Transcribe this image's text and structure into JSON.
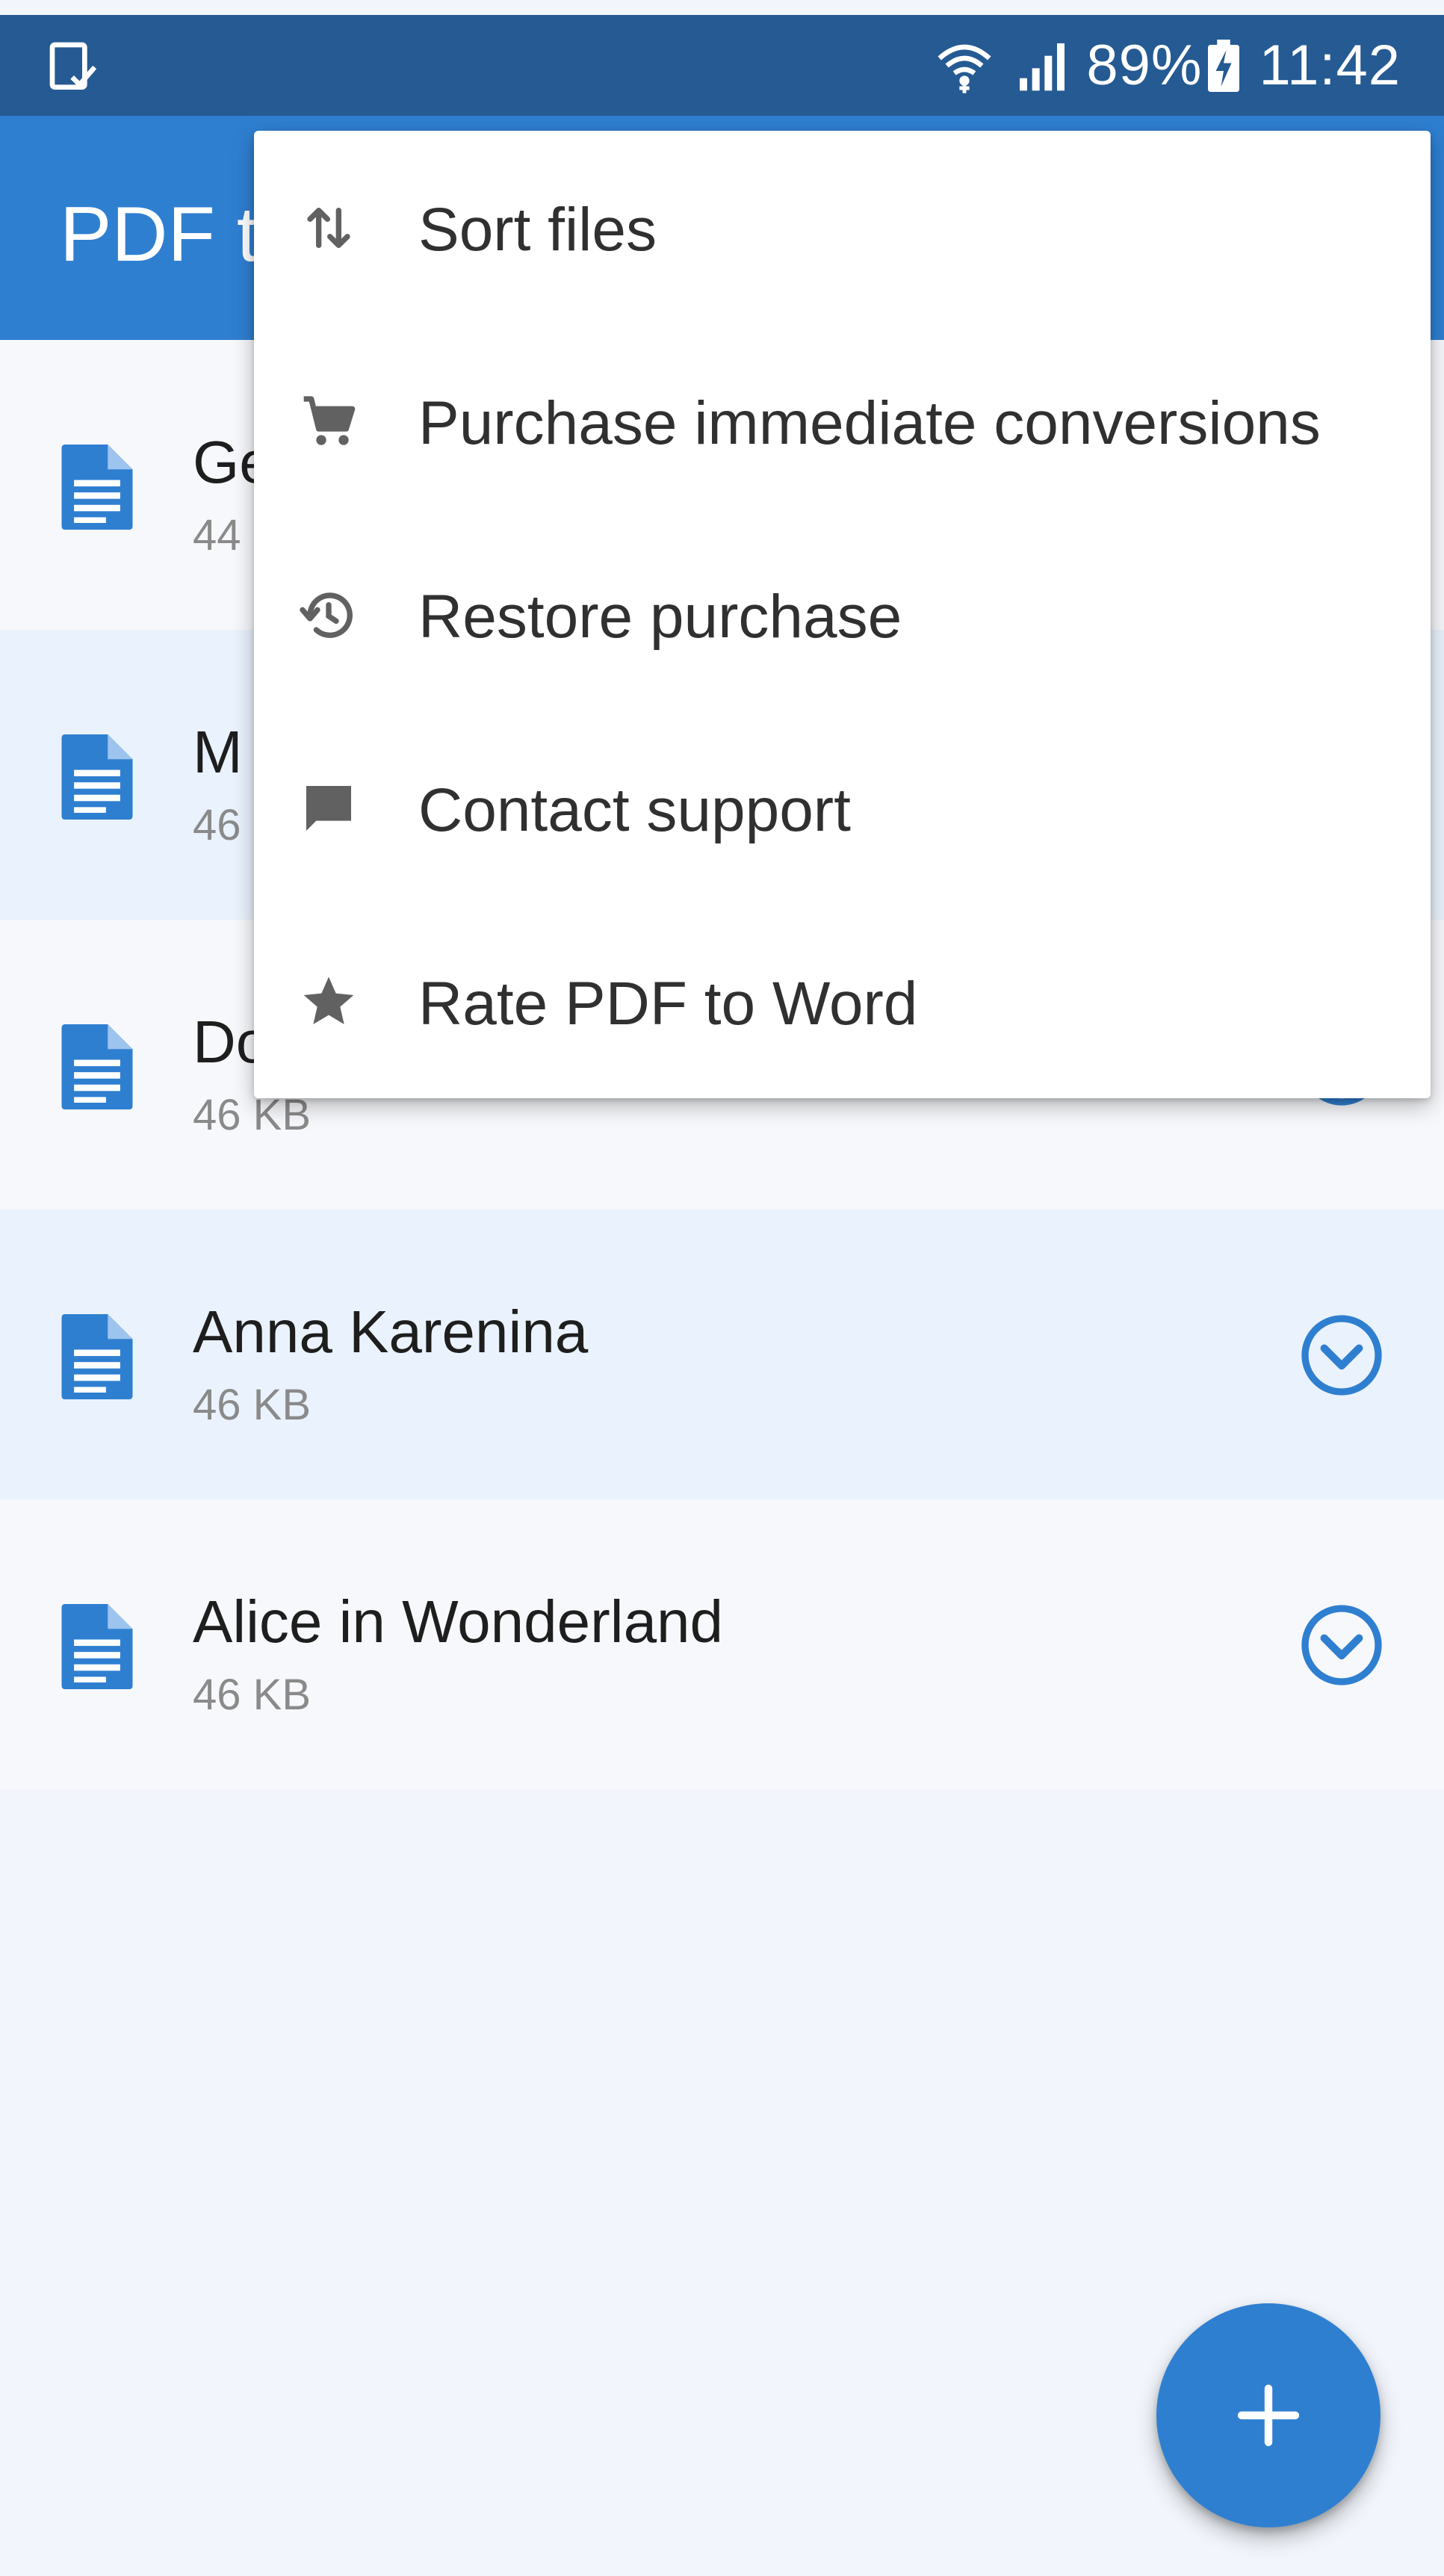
{
  "status_bar": {
    "battery_percent": "89%",
    "time": "11:42",
    "icons": [
      "screenshot-notification-icon",
      "wifi-icon",
      "signal-icon",
      "battery-charging-icon"
    ]
  },
  "app_bar": {
    "title": "PDF t"
  },
  "files": [
    {
      "name": "Ge",
      "size": "44"
    },
    {
      "name": "M",
      "size": "46"
    },
    {
      "name": "Do",
      "size": "46 KB"
    },
    {
      "name": "Anna Karenina",
      "size": "46 KB"
    },
    {
      "name": "Alice in Wonderland",
      "size": "46 KB"
    }
  ],
  "menu": {
    "items": [
      {
        "label": "Sort files",
        "icon": "sort-icon"
      },
      {
        "label": "Purchase immediate conversions",
        "icon": "cart-icon"
      },
      {
        "label": "Restore purchase",
        "icon": "history-icon"
      },
      {
        "label": "Contact support",
        "icon": "chat-icon"
      },
      {
        "label": "Rate PDF to Word",
        "icon": "star-icon"
      }
    ]
  },
  "fab": {
    "icon": "plus-icon"
  },
  "colors": {
    "status_bar": "#255a93",
    "app_bar": "#2f7fd1",
    "accent": "#2f7fd1",
    "row_alt": "#eaf2fd",
    "menu_bg": "#ffffff"
  }
}
